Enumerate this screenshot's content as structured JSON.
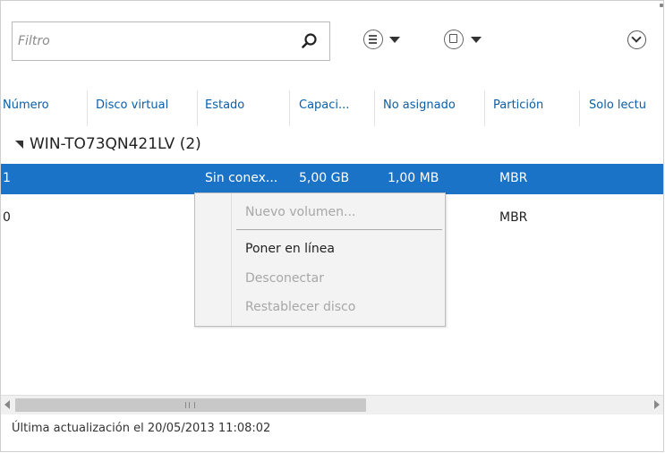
{
  "toolbar": {
    "filter_placeholder": "Filtro",
    "icons": [
      "search-icon",
      "view-options-icon",
      "save-query-icon",
      "expand-icon"
    ]
  },
  "columns": [
    "Número",
    "Disco virtual",
    "Estado",
    "Capaci...",
    "No asignado",
    "Partición",
    "Solo lectu"
  ],
  "group": {
    "label": "WIN-TO73QN421LV (2)",
    "expanded": true
  },
  "rows": [
    {
      "numero": "1",
      "estado": "Sin conex...",
      "capacidad": "5,00 GB",
      "no_asignado": "1,00 MB",
      "particion": "MBR",
      "selected": true
    },
    {
      "numero": "0",
      "particion": "MBR",
      "selected": false
    }
  ],
  "context_menu": {
    "items": [
      {
        "label": "Nuevo volumen...",
        "enabled": false
      },
      {
        "label": "Poner en línea",
        "enabled": true
      },
      {
        "label": "Desconectar",
        "enabled": false
      },
      {
        "label": "Restablecer disco",
        "enabled": false
      }
    ]
  },
  "status": {
    "text": "Última actualización el 20/05/2013 11:08:02"
  },
  "colors": {
    "selection": "#1a73c7",
    "header_text": "#0a5ea8",
    "disabled_text": "#a7a7a7"
  }
}
